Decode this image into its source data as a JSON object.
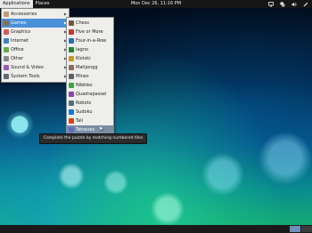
{
  "topbar": {
    "applications": "Applications",
    "places": "Places",
    "clock": "Mon Dec 26, 11:16 PM"
  },
  "categories": [
    {
      "label": "Accessories",
      "icon": "accessories-icon",
      "color": "#c49a6c"
    },
    {
      "label": "Games",
      "icon": "games-icon",
      "color": "#8c6f4a"
    },
    {
      "label": "Graphics",
      "icon": "graphics-icon",
      "color": "#d35d5d"
    },
    {
      "label": "Internet",
      "icon": "internet-icon",
      "color": "#3e7fc5"
    },
    {
      "label": "Office",
      "icon": "office-icon",
      "color": "#6aa84f"
    },
    {
      "label": "Other",
      "icon": "other-icon",
      "color": "#888888"
    },
    {
      "label": "Sound & Video",
      "icon": "sound-video-icon",
      "color": "#9b59b6"
    },
    {
      "label": "System Tools",
      "icon": "system-tools-icon",
      "color": "#5f6b75"
    }
  ],
  "games": [
    {
      "label": "Chess",
      "icon": "chess-icon",
      "color": "#6b5a3e"
    },
    {
      "label": "Five or More",
      "icon": "five-or-more-icon",
      "color": "#c0392b"
    },
    {
      "label": "Four-in-a-Row",
      "icon": "four-in-a-row-icon",
      "color": "#2c6fb5"
    },
    {
      "label": "Iagno",
      "icon": "iagno-icon",
      "color": "#2e7d32"
    },
    {
      "label": "Klotski",
      "icon": "klotski-icon",
      "color": "#c8952c"
    },
    {
      "label": "Mahjongg",
      "icon": "mahjongg-icon",
      "color": "#8d6e63"
    },
    {
      "label": "Mines",
      "icon": "mines-icon",
      "color": "#616161"
    },
    {
      "label": "Nibbles",
      "icon": "nibbles-icon",
      "color": "#43a047"
    },
    {
      "label": "Quadrapassel",
      "icon": "quadrapassel-icon",
      "color": "#8e44ad"
    },
    {
      "label": "Robots",
      "icon": "robots-icon",
      "color": "#546e7a"
    },
    {
      "label": "Sudoku",
      "icon": "sudoku-icon",
      "color": "#1976d2"
    },
    {
      "label": "Tali",
      "icon": "tali-icon",
      "color": "#d84315"
    },
    {
      "label": "Tetravex",
      "icon": "tetravex-icon",
      "color": "#5c6bc0"
    }
  ],
  "tooltip": "Complete the puzzle by matching numbered tiles",
  "colors": {
    "selected": "#4a90d9",
    "hover": "#7a8da5",
    "menu_bg": "#eeeeec",
    "panel": "#161616"
  }
}
